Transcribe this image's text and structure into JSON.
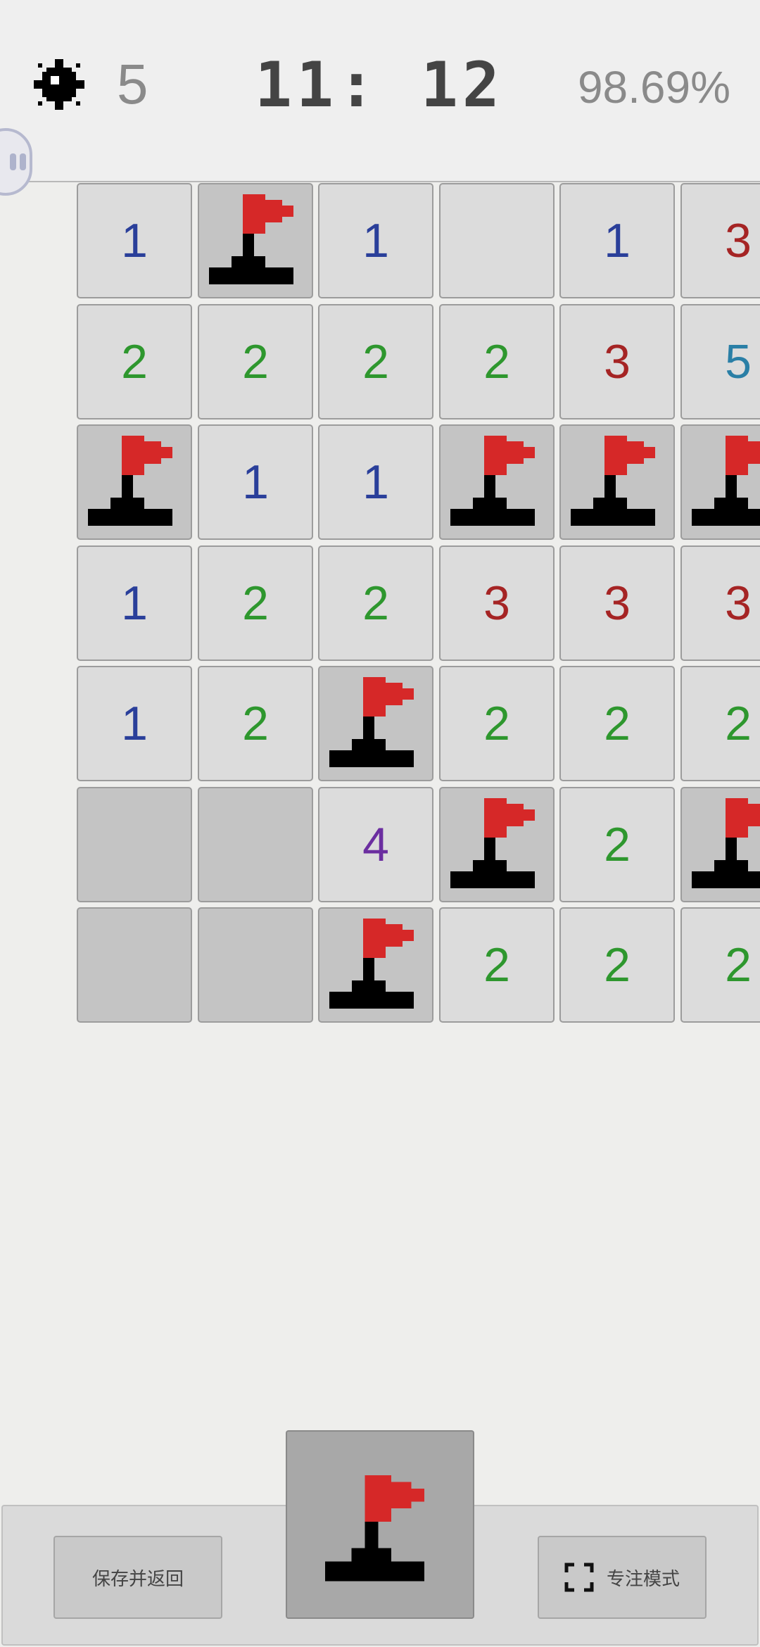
{
  "header": {
    "mines_remaining": "5",
    "timer": "11: 12",
    "progress": "98.69%",
    "mine_icon": "mine-icon"
  },
  "board": {
    "cell_types": {
      "n": "revealed cell showing adjacent mine count",
      "empty": "revealed blank cell",
      "closed": "unrevealed cell",
      "flag": "flagged cell"
    },
    "flag_icon": "flag-icon",
    "rows": [
      [
        {
          "t": "n",
          "v": "1"
        },
        {
          "t": "flag"
        },
        {
          "t": "n",
          "v": "1"
        },
        {
          "t": "empty"
        },
        {
          "t": "n",
          "v": "1"
        },
        {
          "t": "n",
          "v": "3"
        }
      ],
      [
        {
          "t": "n",
          "v": "2"
        },
        {
          "t": "n",
          "v": "2"
        },
        {
          "t": "n",
          "v": "2"
        },
        {
          "t": "n",
          "v": "2"
        },
        {
          "t": "n",
          "v": "3"
        },
        {
          "t": "n",
          "v": "5"
        }
      ],
      [
        {
          "t": "flag"
        },
        {
          "t": "n",
          "v": "1"
        },
        {
          "t": "n",
          "v": "1"
        },
        {
          "t": "flag"
        },
        {
          "t": "flag"
        },
        {
          "t": "flag"
        }
      ],
      [
        {
          "t": "n",
          "v": "1"
        },
        {
          "t": "n",
          "v": "2"
        },
        {
          "t": "n",
          "v": "2"
        },
        {
          "t": "n",
          "v": "3"
        },
        {
          "t": "n",
          "v": "3"
        },
        {
          "t": "n",
          "v": "3"
        }
      ],
      [
        {
          "t": "n",
          "v": "1"
        },
        {
          "t": "n",
          "v": "2"
        },
        {
          "t": "flag"
        },
        {
          "t": "n",
          "v": "2"
        },
        {
          "t": "n",
          "v": "2"
        },
        {
          "t": "n",
          "v": "2"
        }
      ],
      [
        {
          "t": "closed"
        },
        {
          "t": "closed"
        },
        {
          "t": "n",
          "v": "4"
        },
        {
          "t": "flag"
        },
        {
          "t": "n",
          "v": "2"
        },
        {
          "t": "flag"
        }
      ],
      [
        {
          "t": "closed"
        },
        {
          "t": "closed"
        },
        {
          "t": "flag"
        },
        {
          "t": "n",
          "v": "2"
        },
        {
          "t": "n",
          "v": "2"
        },
        {
          "t": "n",
          "v": "2"
        }
      ]
    ]
  },
  "colors": {
    "1": "#2a3f9a",
    "2": "#2e972e",
    "3": "#a52424",
    "4": "#6b2ea0",
    "5": "#2a7fa6",
    "flag_red": "#d62828"
  },
  "bottom": {
    "save_label": "保存并返回",
    "focus_label": "专注模式",
    "mode_icon": "flag-icon",
    "focus_icon": "fullscreen-icon"
  }
}
